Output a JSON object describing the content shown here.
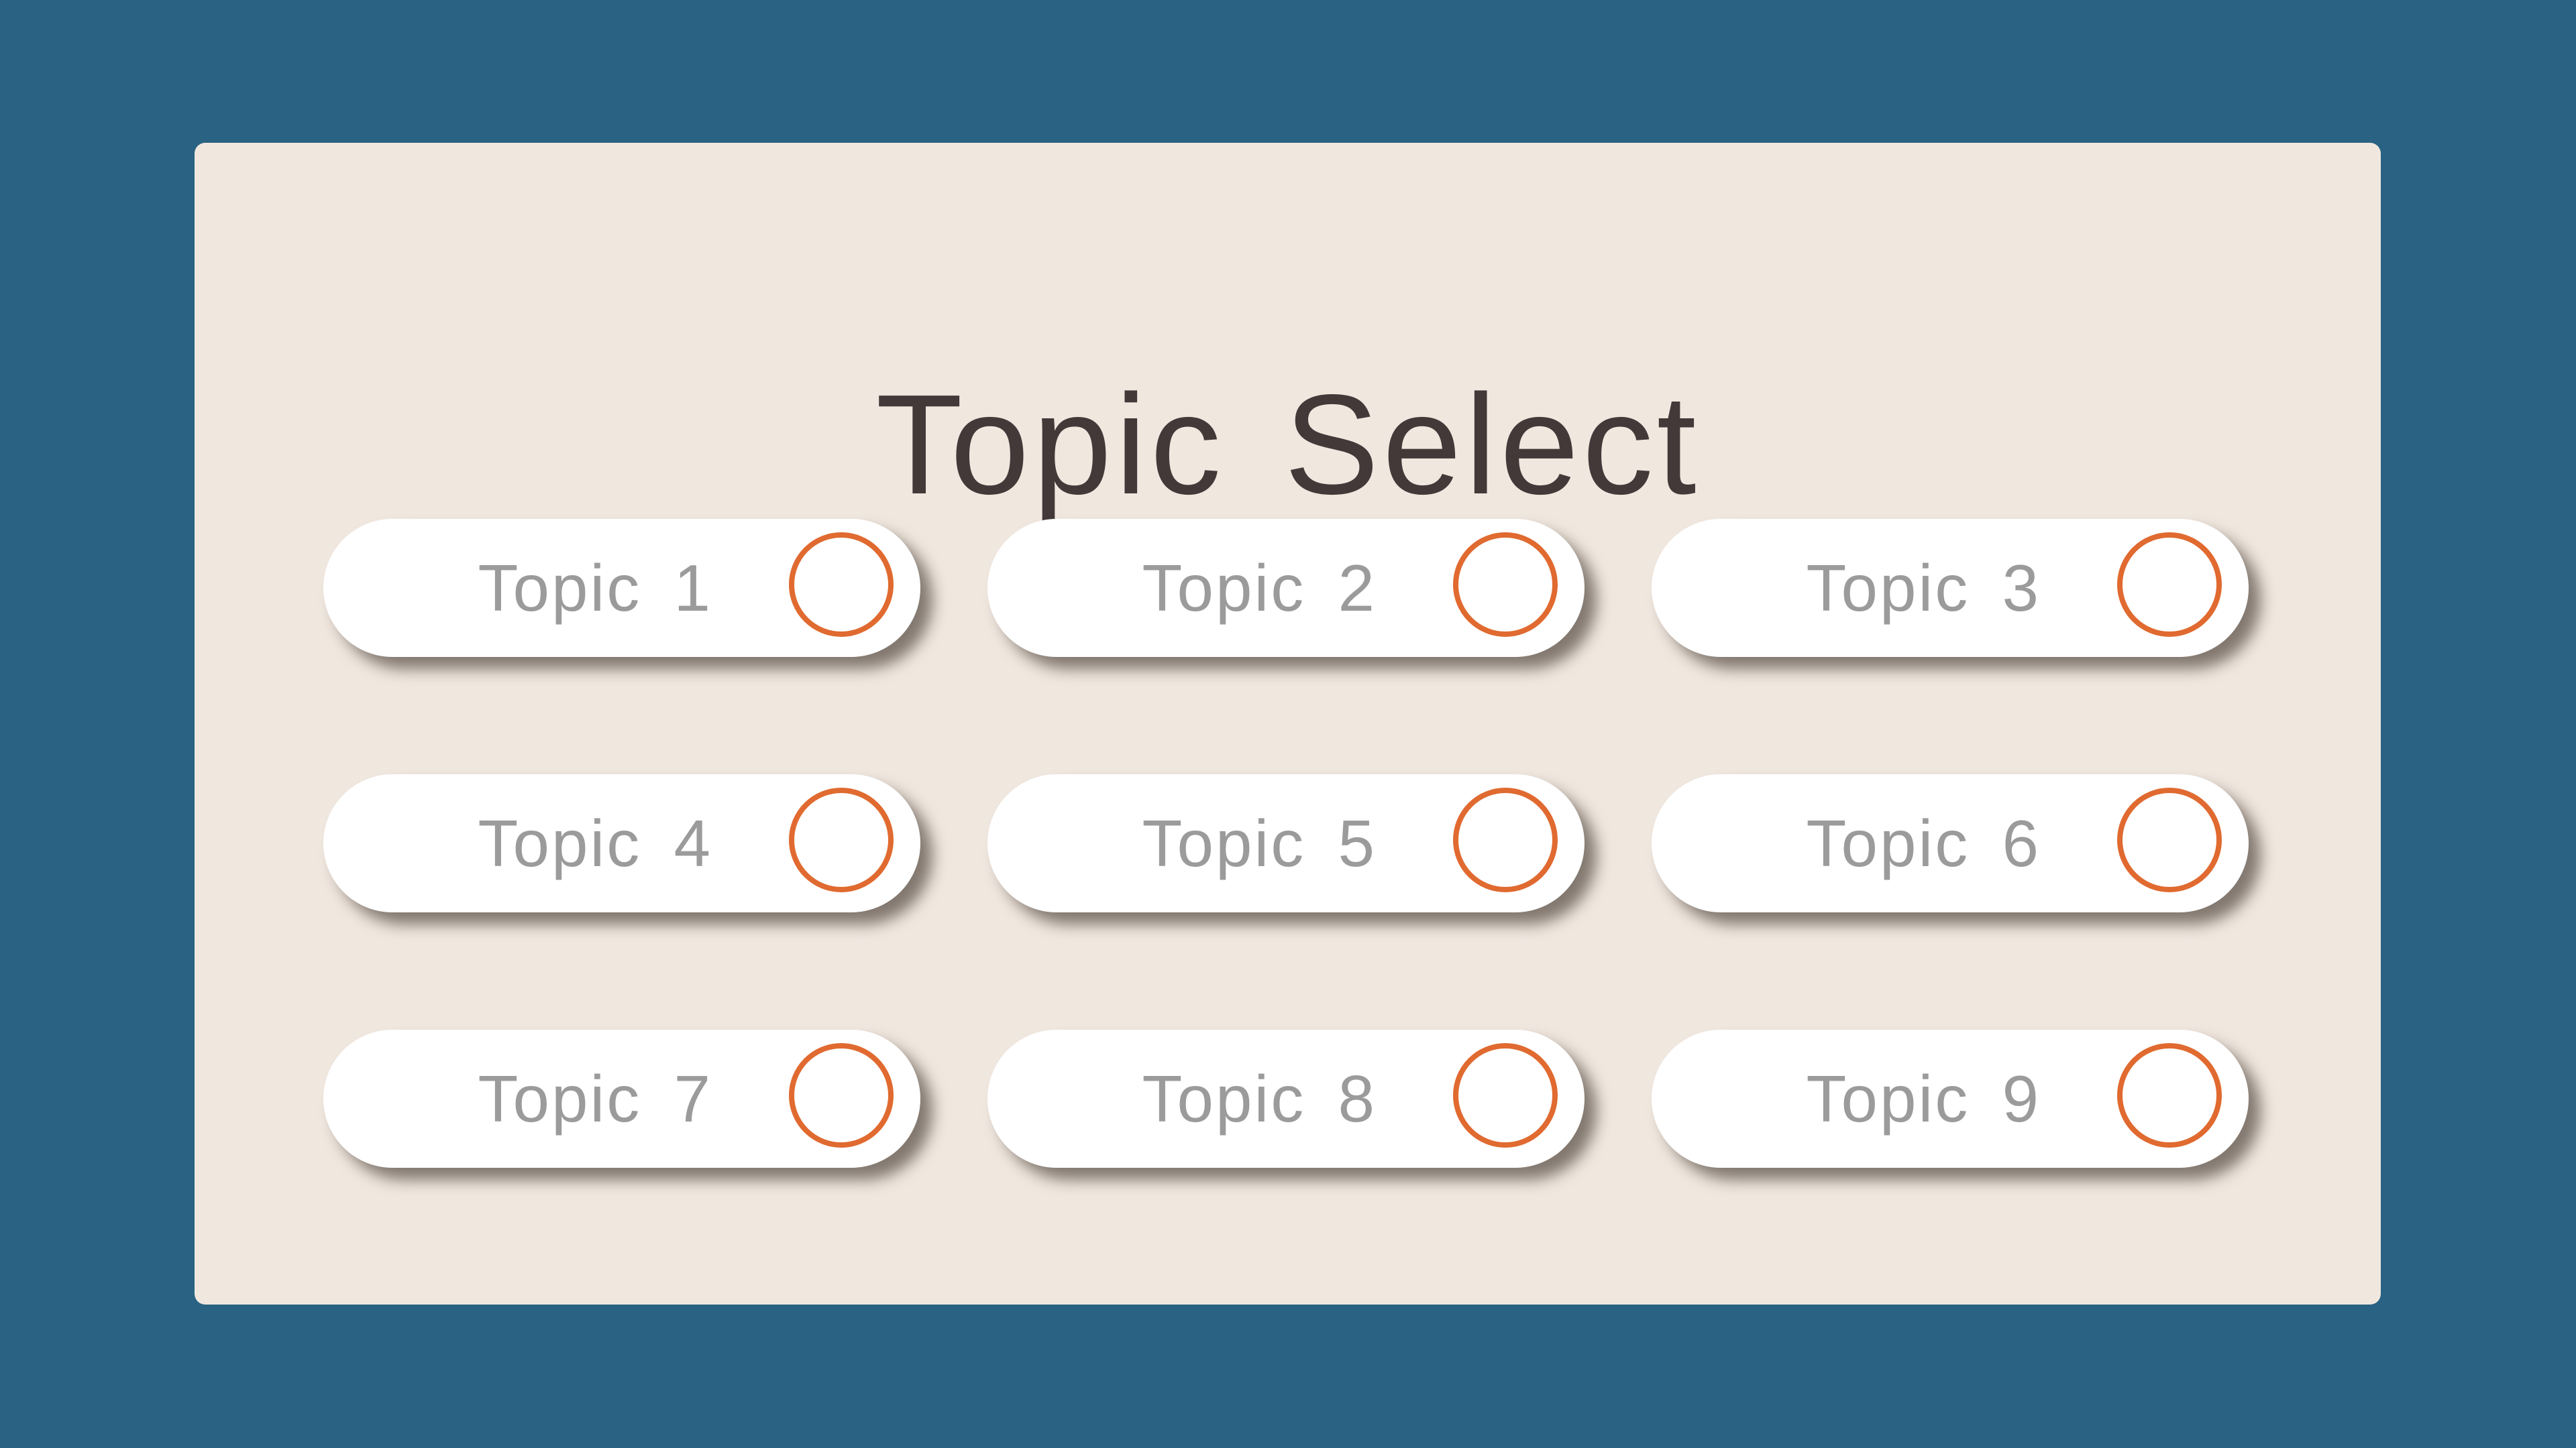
{
  "page": {
    "title": "Topic Select"
  },
  "topics": [
    {
      "label": "Topic 1"
    },
    {
      "label": "Topic 2"
    },
    {
      "label": "Topic 3"
    },
    {
      "label": "Topic 4"
    },
    {
      "label": "Topic 5"
    },
    {
      "label": "Topic 6"
    },
    {
      "label": "Topic 7"
    },
    {
      "label": "Topic 8"
    },
    {
      "label": "Topic 9"
    }
  ],
  "colors": {
    "background": "#296282",
    "panel": "#f0e7df",
    "title_text": "#443939",
    "option_text": "#9b9b9b",
    "radio_ring": "#e06a30"
  },
  "icons": {
    "radio": "radio-unchecked-icon"
  }
}
